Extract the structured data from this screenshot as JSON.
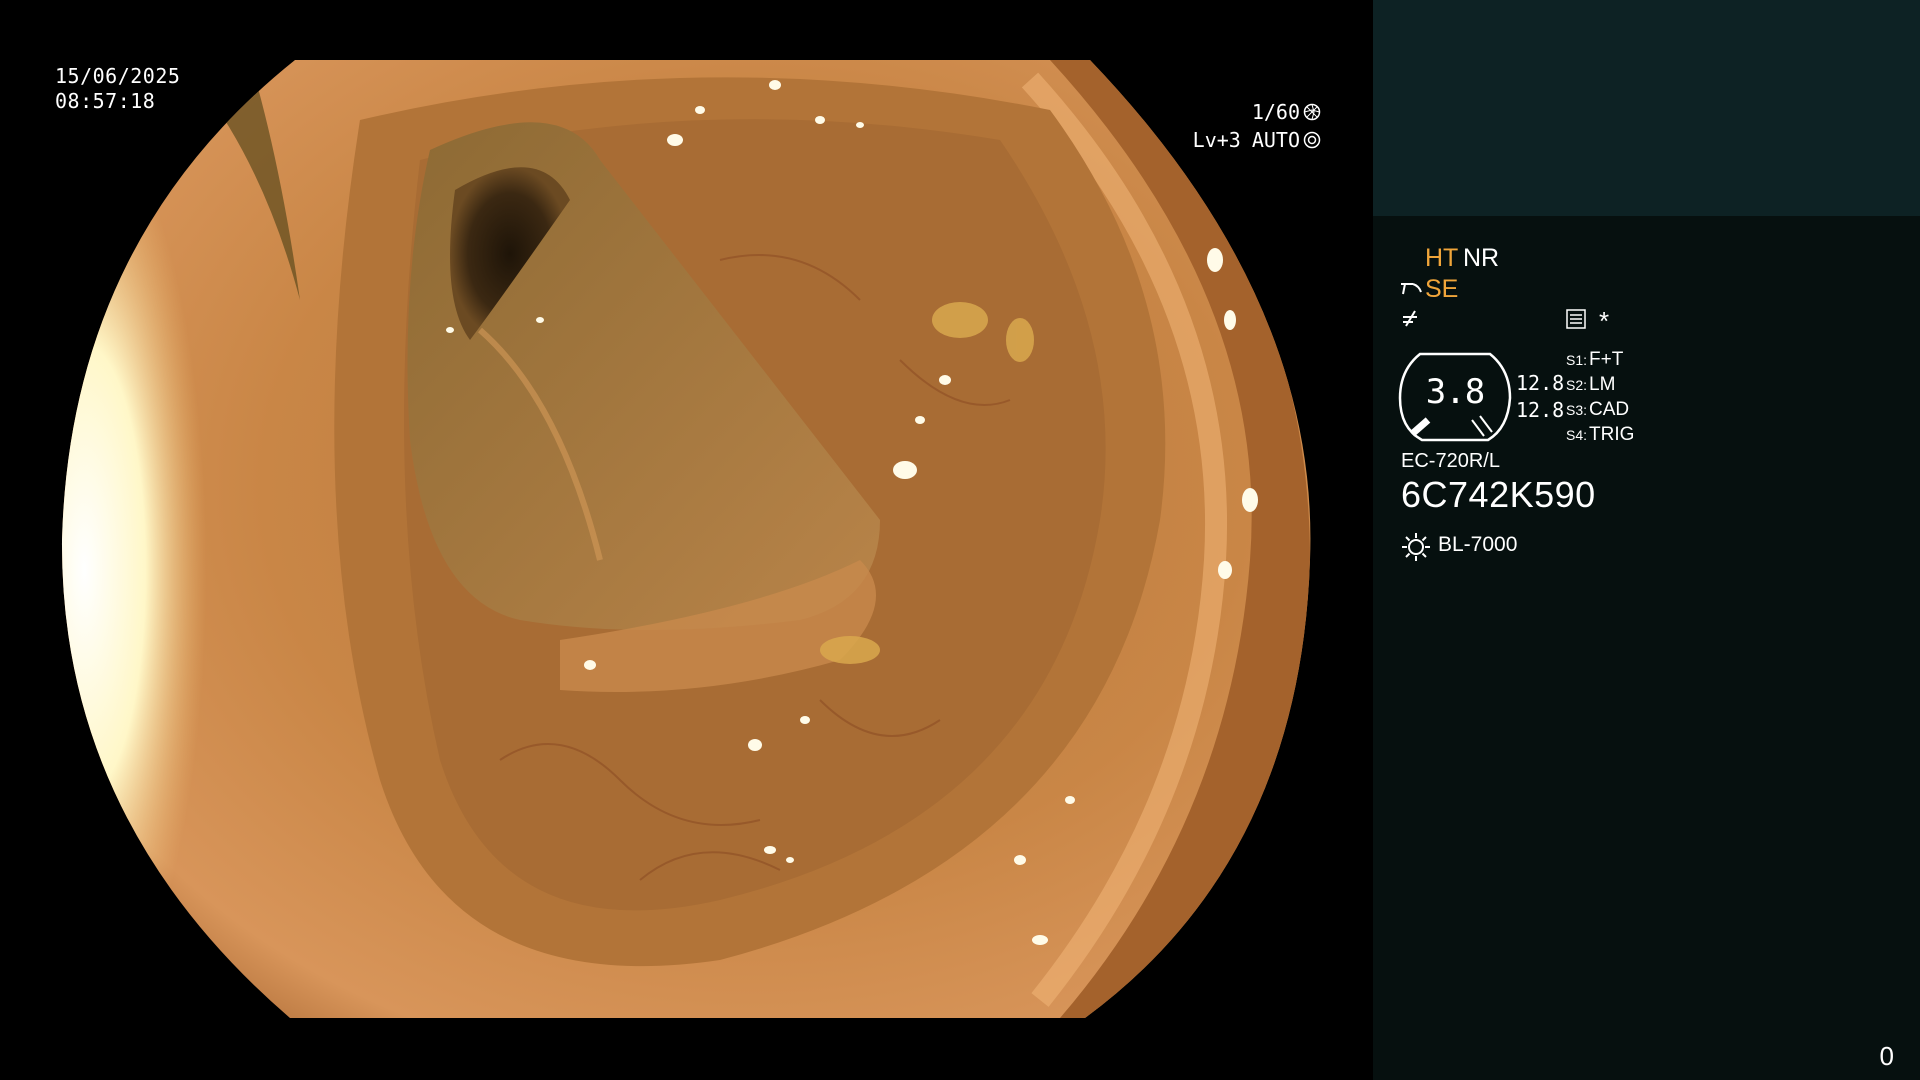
{
  "osd": {
    "date": "15/06/2025",
    "time": "08:57:18",
    "shutter": "1/60",
    "level": "Lv+3",
    "mode": "AUTO"
  },
  "panel": {
    "ht_label": "HT",
    "nr_label": "NR",
    "se_label": "SE",
    "gauge_value": "3.8",
    "value_1": "12.8",
    "value_2": "12.8",
    "s_items": [
      {
        "key": "S1:",
        "value": "F+T"
      },
      {
        "key": "S2:",
        "value": "LM"
      },
      {
        "key": "S3:",
        "value": "CAD"
      },
      {
        "key": "S4:",
        "value": "TRIG"
      }
    ],
    "scope_model": "EC-720R/L",
    "scope_serial": "6C742K590",
    "light_source": "BL-7000",
    "counter": "0",
    "asterisk": "*"
  },
  "colors": {
    "panel_bg": "#06100f",
    "panel_top_bg": "#0d2224",
    "accent_orange": "#f0a53a",
    "mucosa": "#c07a3c"
  },
  "icons": [
    "shutter-icon",
    "auto-iris-icon",
    "scope-tip-icon",
    "freeze-icon",
    "report-icon",
    "light-source-icon"
  ]
}
